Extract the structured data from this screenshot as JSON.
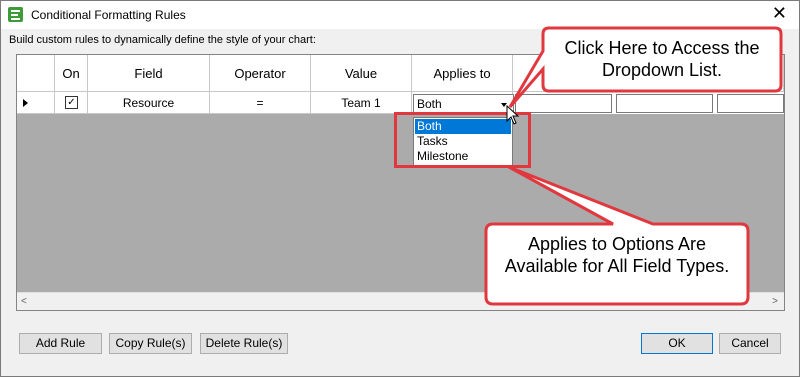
{
  "window": {
    "title": "Conditional Formatting Rules",
    "caption": "Build custom rules to dynamically define the style of your chart:",
    "close_glyph": "✕"
  },
  "grid": {
    "headers": [
      "On",
      "Field",
      "Operator",
      "Value",
      "Applies to"
    ],
    "row": {
      "on_checked": true,
      "check_glyph": "✓",
      "field": "Resource",
      "operator": "=",
      "value": "Team 1",
      "applies_to": "Both"
    }
  },
  "dropdown": {
    "options": [
      "Both",
      "Tasks",
      "Milestone"
    ],
    "selected": "Both"
  },
  "callouts": {
    "top": "Click Here to Access the Dropdown List.",
    "bottom": "Applies to Options Are Available for All Field Types."
  },
  "buttons": {
    "add_rule": "Add Rule",
    "copy_rules": "Copy Rule(s)",
    "delete_rules": "Delete Rule(s)",
    "ok": "OK",
    "cancel": "Cancel"
  },
  "scroll": {
    "left_glyph": "<",
    "right_glyph": ">"
  },
  "colors": {
    "callout_fill": "#ffffff",
    "callout_border": "#e0383e",
    "selection": "#0078d7",
    "grid_bg": "#ababab",
    "app_icon": "#3f9b3a"
  },
  "icons": {
    "app": "app-grid-icon",
    "close": "close-icon",
    "row_selector": "row-selector-arrow-icon",
    "combo": "chevron-down-icon",
    "cursor": "mouse-pointer-icon"
  }
}
